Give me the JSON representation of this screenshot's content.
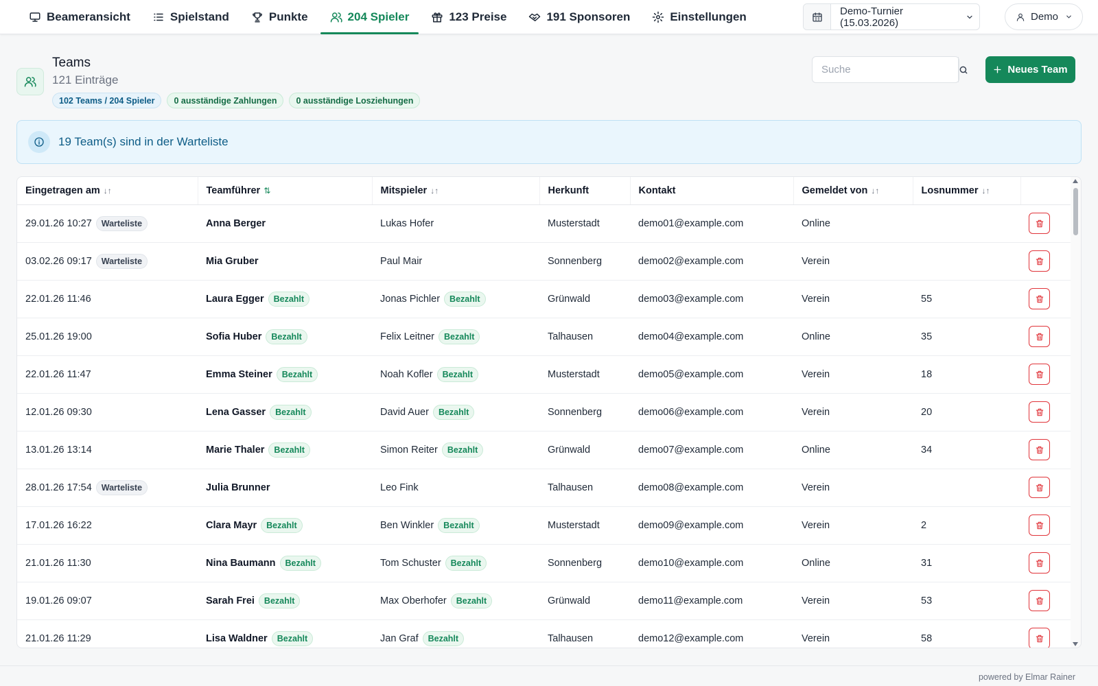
{
  "nav": {
    "items": [
      {
        "label": "Beameransicht",
        "icon": "monitor-icon"
      },
      {
        "label": "Spielstand",
        "icon": "list-icon"
      },
      {
        "label": "Punkte",
        "icon": "trophy-icon"
      },
      {
        "label": "204 Spieler",
        "icon": "users-icon",
        "active": true
      },
      {
        "label": "123 Preise",
        "icon": "gift-icon"
      },
      {
        "label": "191 Sponsoren",
        "icon": "handshake-icon"
      },
      {
        "label": "Einstellungen",
        "icon": "gear-icon"
      }
    ],
    "tournament": "Demo-Turnier (15.03.2026)",
    "user": "Demo"
  },
  "header": {
    "title": "Teams",
    "subtitle": "121 Einträge",
    "badges": [
      "102 Teams / 204 Spieler",
      "0 ausständige Zahlungen",
      "0 ausständige Losziehungen"
    ],
    "search_placeholder": "Suche",
    "new_team_label": "Neues Team"
  },
  "alert": {
    "text": "19 Team(s) sind in der Warteliste"
  },
  "table": {
    "columns": [
      "Eingetragen am",
      "Teamführer",
      "Mitspieler",
      "Herkunft",
      "Kontakt",
      "Gemeldet von",
      "Losnummer"
    ],
    "rows": [
      {
        "date": "29.01.26 10:27",
        "status": "Warteliste",
        "leader": "Anna Berger",
        "leader_tag": "",
        "mate": "Lukas Hofer",
        "mate_tag": "",
        "origin": "Musterstadt",
        "contact": "demo01@example.com",
        "via": "Online",
        "lot": ""
      },
      {
        "date": "03.02.26 09:17",
        "status": "Warteliste",
        "leader": "Mia Gruber",
        "leader_tag": "",
        "mate": "Paul Mair",
        "mate_tag": "",
        "origin": "Sonnenberg",
        "contact": "demo02@example.com",
        "via": "Verein",
        "lot": ""
      },
      {
        "date": "22.01.26 11:46",
        "status": "",
        "leader": "Laura Egger",
        "leader_tag": "Bezahlt",
        "mate": "Jonas Pichler",
        "mate_tag": "Bezahlt",
        "origin": "Grünwald",
        "contact": "demo03@example.com",
        "via": "Verein",
        "lot": "55"
      },
      {
        "date": "25.01.26 19:00",
        "status": "",
        "leader": "Sofia Huber",
        "leader_tag": "Bezahlt",
        "mate": "Felix Leitner",
        "mate_tag": "Bezahlt",
        "origin": "Talhausen",
        "contact": "demo04@example.com",
        "via": "Online",
        "lot": "35"
      },
      {
        "date": "22.01.26 11:47",
        "status": "",
        "leader": "Emma Steiner",
        "leader_tag": "Bezahlt",
        "mate": "Noah Kofler",
        "mate_tag": "Bezahlt",
        "origin": "Musterstadt",
        "contact": "demo05@example.com",
        "via": "Verein",
        "lot": "18"
      },
      {
        "date": "12.01.26 09:30",
        "status": "",
        "leader": "Lena Gasser",
        "leader_tag": "Bezahlt",
        "mate": "David Auer",
        "mate_tag": "Bezahlt",
        "origin": "Sonnenberg",
        "contact": "demo06@example.com",
        "via": "Verein",
        "lot": "20"
      },
      {
        "date": "13.01.26 13:14",
        "status": "",
        "leader": "Marie Thaler",
        "leader_tag": "Bezahlt",
        "mate": "Simon Reiter",
        "mate_tag": "Bezahlt",
        "origin": "Grünwald",
        "contact": "demo07@example.com",
        "via": "Online",
        "lot": "34"
      },
      {
        "date": "28.01.26 17:54",
        "status": "Warteliste",
        "leader": "Julia Brunner",
        "leader_tag": "",
        "mate": "Leo Fink",
        "mate_tag": "",
        "origin": "Talhausen",
        "contact": "demo08@example.com",
        "via": "Verein",
        "lot": ""
      },
      {
        "date": "17.01.26 16:22",
        "status": "",
        "leader": "Clara Mayr",
        "leader_tag": "Bezahlt",
        "mate": "Ben Winkler",
        "mate_tag": "Bezahlt",
        "origin": "Musterstadt",
        "contact": "demo09@example.com",
        "via": "Verein",
        "lot": "2"
      },
      {
        "date": "21.01.26 11:30",
        "status": "",
        "leader": "Nina Baumann",
        "leader_tag": "Bezahlt",
        "mate": "Tom Schuster",
        "mate_tag": "Bezahlt",
        "origin": "Sonnenberg",
        "contact": "demo10@example.com",
        "via": "Online",
        "lot": "31"
      },
      {
        "date": "19.01.26 09:07",
        "status": "",
        "leader": "Sarah Frei",
        "leader_tag": "Bezahlt",
        "mate": "Max Oberhofer",
        "mate_tag": "Bezahlt",
        "origin": "Grünwald",
        "contact": "demo11@example.com",
        "via": "Verein",
        "lot": "53"
      },
      {
        "date": "21.01.26 11:29",
        "status": "",
        "leader": "Lisa Waldner",
        "leader_tag": "Bezahlt",
        "mate": "Jan Graf",
        "mate_tag": "Bezahlt",
        "origin": "Talhausen",
        "contact": "demo12@example.com",
        "via": "Verein",
        "lot": "58"
      }
    ]
  },
  "footer": {
    "text": "powered by Elmar Rainer"
  },
  "colors": {
    "accent": "#15885a",
    "info": "#0d5c86",
    "danger": "#e0343a"
  }
}
